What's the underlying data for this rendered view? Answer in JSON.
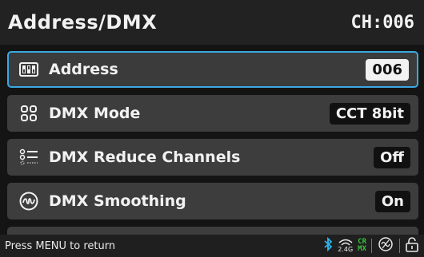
{
  "header": {
    "title": "Address/DMX",
    "channel": "CH:006"
  },
  "menu": {
    "items": [
      {
        "label": "Address",
        "value": "006",
        "icon": "dip-switch-icon"
      },
      {
        "label": "DMX Mode",
        "value": "CCT 8bit",
        "icon": "grid-icon"
      },
      {
        "label": "DMX Reduce Channels",
        "value": "Off",
        "icon": "list-icon"
      },
      {
        "label": "DMX Smoothing",
        "value": "On",
        "icon": "wave-icon"
      }
    ]
  },
  "footer": {
    "hint": "Press MENU to return",
    "wifi_band": "2.4G",
    "crmx_top": "CR",
    "crmx_bottom": "MX",
    "colors": {
      "bluetooth": "#2fb4e8",
      "crmx": "#39c43a",
      "accent": "#3aa8e2"
    }
  }
}
